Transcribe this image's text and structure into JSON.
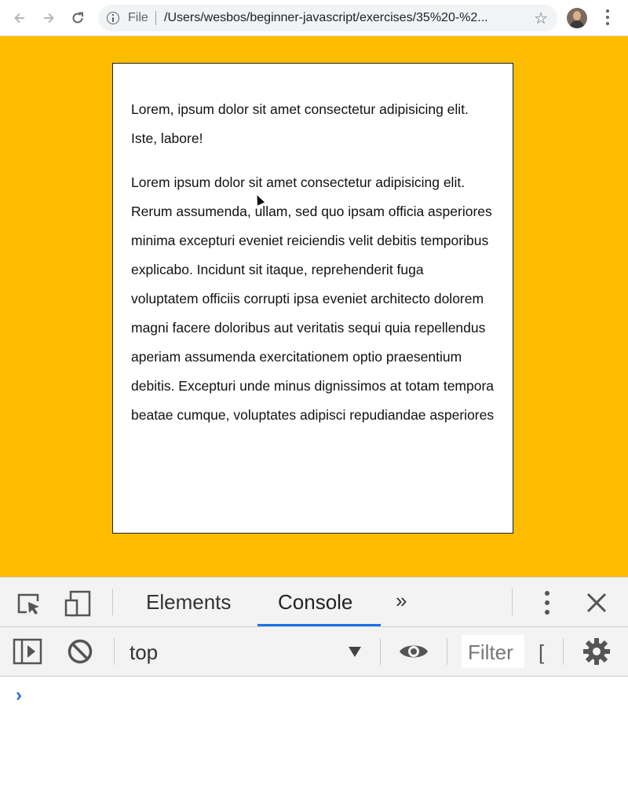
{
  "browser": {
    "scheme_label": "File",
    "url": "/Users/wesbos/beginner-javascript/exercises/35%20-%2..."
  },
  "page": {
    "paragraphs": [
      "Lorem, ipsum dolor sit amet consectetur adipisicing elit. Iste, labore!",
      "Lorem ipsum dolor sit amet consectetur adipisicing elit. Rerum assumenda, ullam, sed quo ipsam officia asperiores minima excepturi eveniet reiciendis velit debitis temporibus explicabo. Incidunt sit itaque, reprehenderit fuga voluptatem officiis corrupti ipsa eveniet architecto dolorem magni facere doloribus aut veritatis sequi quia repellendus aperiam assumenda exercitationem optio praesentium debitis. Excepturi unde minus dignissimos at totam tempora beatae cumque, voluptates adipisci repudiandae asperiores"
    ],
    "background_color": "#fdbc00"
  },
  "devtools": {
    "tabs": [
      "Elements",
      "Console"
    ],
    "active_tab": "Console",
    "more_tabs_glyph": "»",
    "context": "top",
    "filter_placeholder": "Filter",
    "truncated_glyph": "[",
    "prompt_glyph": "›",
    "accent_color": "#1a73e8"
  }
}
